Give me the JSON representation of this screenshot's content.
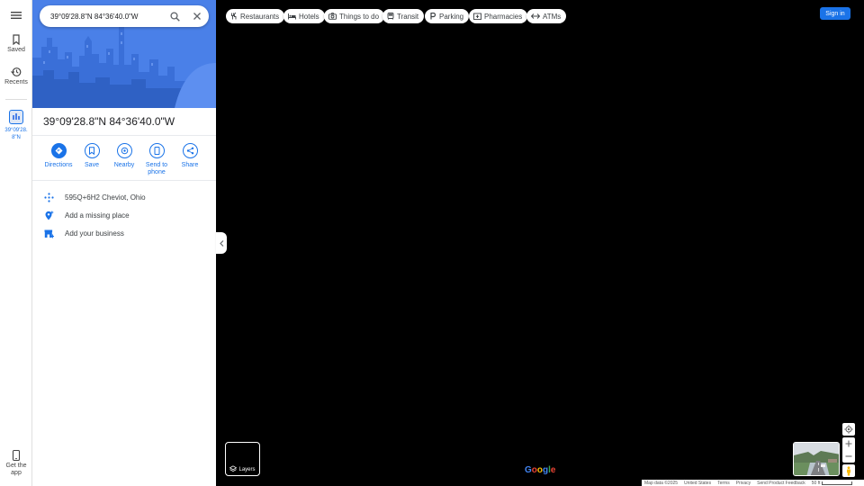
{
  "rail": {
    "menu_icon": "menu-icon",
    "saved_label": "Saved",
    "recents_label": "Recents",
    "place_label": "39°09'28.8\"N",
    "get_app_label": "Get the app"
  },
  "search": {
    "value": "39°09'28.8\"N 84°36'40.0\"W",
    "search_icon": "search-icon",
    "clear_icon": "close-icon"
  },
  "place": {
    "title": "39°09'28.8\"N 84°36'40.0\"W",
    "actions": [
      {
        "label": "Directions",
        "icon": "directions-icon"
      },
      {
        "label": "Save",
        "icon": "bookmark-icon"
      },
      {
        "label": "Nearby",
        "icon": "nearby-icon"
      },
      {
        "label": "Send to phone",
        "icon": "phone-icon"
      },
      {
        "label": "Share",
        "icon": "share-icon"
      }
    ],
    "info": [
      {
        "text": "595Q+6H2 Cheviot, Ohio",
        "icon": "plus-code-icon"
      },
      {
        "text": "Add a missing place",
        "icon": "add-place-icon"
      },
      {
        "text": "Add your business",
        "icon": "add-business-icon"
      }
    ]
  },
  "chips": [
    {
      "label": "Restaurants",
      "icon": "restaurant-icon"
    },
    {
      "label": "Hotels",
      "icon": "hotel-icon"
    },
    {
      "label": "Things to do",
      "icon": "camera-icon"
    },
    {
      "label": "Transit",
      "icon": "transit-icon"
    },
    {
      "label": "Parking",
      "icon": "parking-icon"
    },
    {
      "label": "Pharmacies",
      "icon": "pharmacy-icon"
    },
    {
      "label": "ATMs",
      "icon": "atm-icon"
    }
  ],
  "header": {
    "sign_in": "Sign in"
  },
  "map": {
    "layers_label": "Layers",
    "logo_text": "Google",
    "footer": {
      "map_data": "Map data ©2025",
      "region": "United States",
      "terms": "Terms",
      "privacy": "Privacy",
      "feedback": "Send Product Feedback",
      "scale": "50 ft"
    }
  },
  "colors": {
    "accent": "#1a73e8",
    "hero_sky": "#4a80e8",
    "map_bg": "#000000"
  }
}
